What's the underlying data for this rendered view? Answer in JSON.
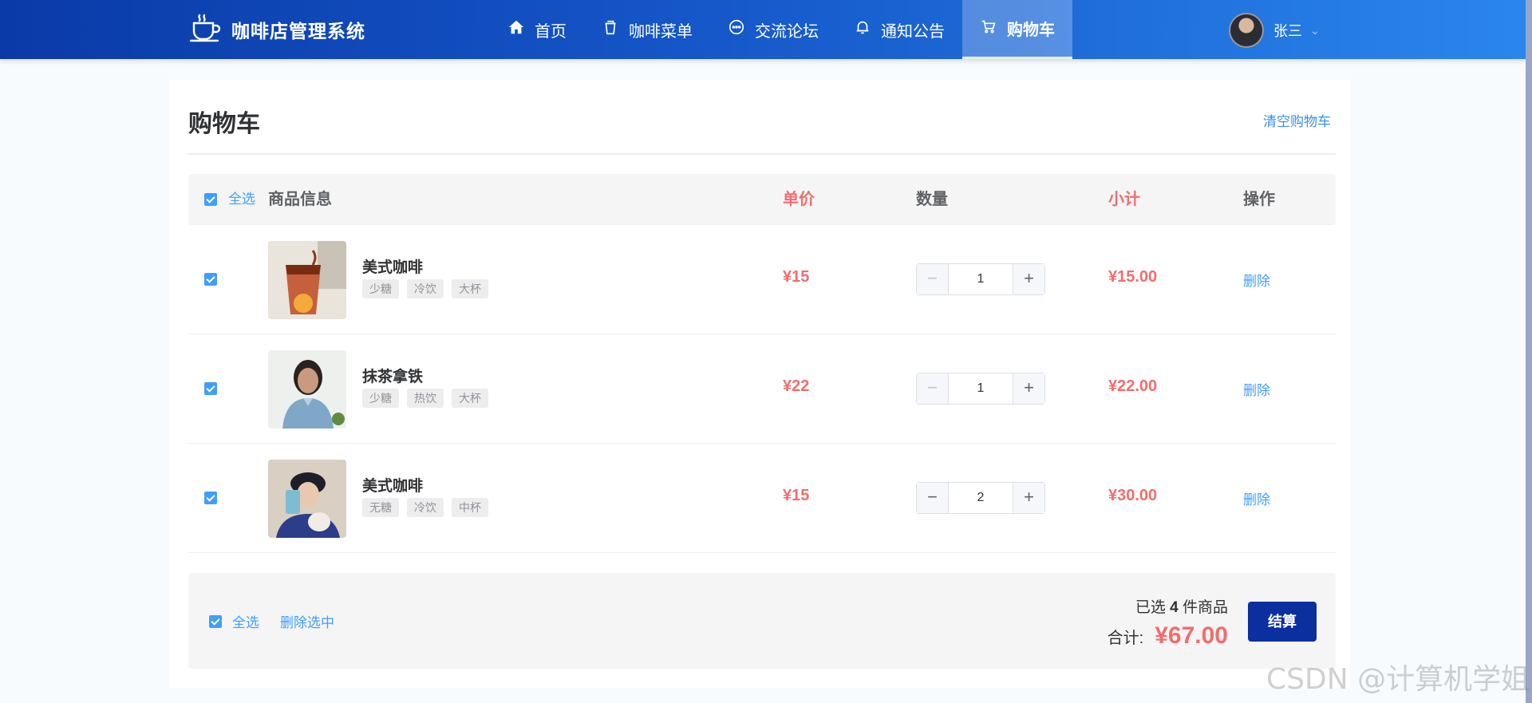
{
  "header": {
    "brand": "咖啡店管理系统",
    "nav": [
      {
        "label": "首页",
        "icon": "home-icon"
      },
      {
        "label": "咖啡菜单",
        "icon": "cup-icon"
      },
      {
        "label": "交流论坛",
        "icon": "chat-icon"
      },
      {
        "label": "通知公告",
        "icon": "bell-icon"
      },
      {
        "label": "购物车",
        "icon": "cart-icon",
        "active": true
      }
    ],
    "user": {
      "name": "张三"
    }
  },
  "cart": {
    "title": "购物车",
    "clear_label": "清空购物车",
    "columns": {
      "select_all": "全选",
      "info": "商品信息",
      "price": "单价",
      "quantity": "数量",
      "subtotal": "小计",
      "action": "操作"
    },
    "items": [
      {
        "name": "美式咖啡",
        "tags": [
          "少糖",
          "冷饮",
          "大杯"
        ],
        "price": "¥15",
        "quantity": "1",
        "subtotal": "¥15.00",
        "delete_label": "删除",
        "checked": true
      },
      {
        "name": "抹茶拿铁",
        "tags": [
          "少糖",
          "热饮",
          "大杯"
        ],
        "price": "¥22",
        "quantity": "1",
        "subtotal": "¥22.00",
        "delete_label": "删除",
        "checked": true
      },
      {
        "name": "美式咖啡",
        "tags": [
          "无糖",
          "冷饮",
          "中杯"
        ],
        "price": "¥15",
        "quantity": "2",
        "subtotal": "¥30.00",
        "delete_label": "删除",
        "checked": true
      }
    ],
    "footer": {
      "select_all": "全选",
      "delete_selected": "删除选中",
      "count_prefix": "已选",
      "count": "4",
      "count_suffix": "件商品",
      "total_label": "合计:",
      "total": "¥67.00",
      "checkout_label": "结算"
    }
  },
  "watermark": "CSDN @计算机学姐",
  "colors": {
    "accent": "#409eff",
    "price": "#f56c6c",
    "header_start": "#0a3aa8",
    "header_end": "#2a86ec",
    "checkout": "#0b2f9e"
  }
}
